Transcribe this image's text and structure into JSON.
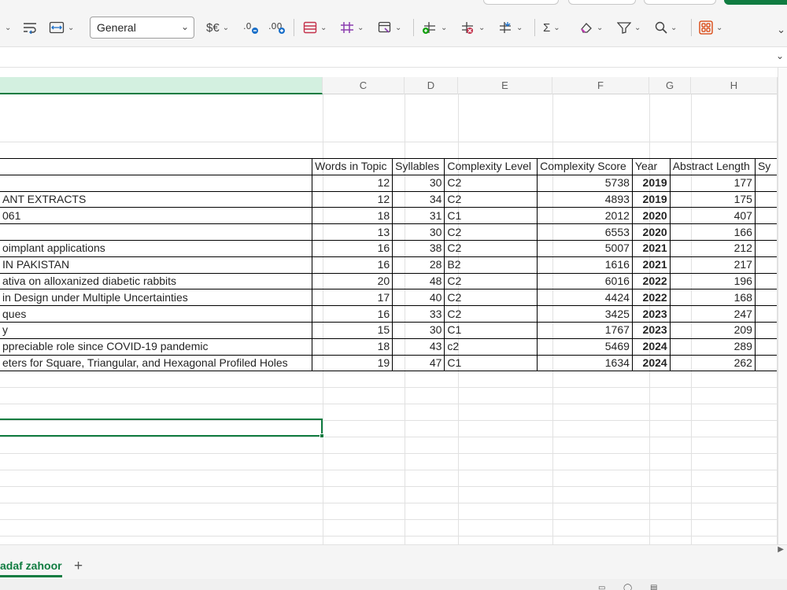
{
  "ribbon": {
    "number_format": "General",
    "icons": [
      "wrap-text-icon",
      "merge-center-icon",
      "currency-format-icon",
      "decrease-decimal-icon",
      "increase-decimal-icon",
      "conditional-format-icon",
      "format-as-table-icon",
      "cell-styles-icon",
      "insert-cells-icon",
      "delete-cells-icon",
      "format-cells-icon",
      "autosum-icon",
      "clear-icon",
      "sort-filter-icon",
      "find-select-icon",
      "add-ins-icon"
    ],
    "currency_glyph": "$€",
    "sigma_glyph": "Σ"
  },
  "columns": [
    "C",
    "D",
    "E",
    "F",
    "G",
    "H"
  ],
  "table": {
    "headers": [
      "",
      "Words in Topic",
      "Syllables",
      "Complexity Level",
      "Complexity Score",
      "Year",
      "Abstract Length",
      "Sy"
    ],
    "rows": [
      [
        "",
        "12",
        "30",
        "C2",
        "5738",
        "2019",
        "177"
      ],
      [
        "ANT EXTRACTS",
        "12",
        "34",
        "C2",
        "4893",
        "2019",
        "175"
      ],
      [
        "061",
        "18",
        "31",
        "C1",
        "2012",
        "2020",
        "407"
      ],
      [
        "",
        "13",
        "30",
        "C2",
        "6553",
        "2020",
        "166"
      ],
      [
        "oimplant applications",
        "16",
        "38",
        "C2",
        "5007",
        "2021",
        "212"
      ],
      [
        " IN PAKISTAN",
        "16",
        "28",
        "B2",
        "1616",
        "2021",
        "217"
      ],
      [
        "ativa on alloxanized diabetic rabbits",
        "20",
        "48",
        "C2",
        "6016",
        "2022",
        "196"
      ],
      [
        "in Design under Multiple Uncertainties",
        "17",
        "40",
        "C2",
        "4424",
        "2022",
        "168"
      ],
      [
        "ques",
        "16",
        "33",
        "C2",
        "3425",
        "2023",
        "247"
      ],
      [
        "y",
        "15",
        "30",
        "C1",
        "1767",
        "2023",
        "209"
      ],
      [
        "ppreciable role since COVID-19 pandemic",
        "18",
        "43",
        "c2",
        "5469",
        "2024",
        "289"
      ],
      [
        "eters for Square, Triangular, and Hexagonal Profiled Holes",
        "19",
        "47",
        "C1",
        "1634",
        "2024",
        "262"
      ]
    ]
  },
  "sheet_tab": "adaf zahoor",
  "add_sheet": "+"
}
